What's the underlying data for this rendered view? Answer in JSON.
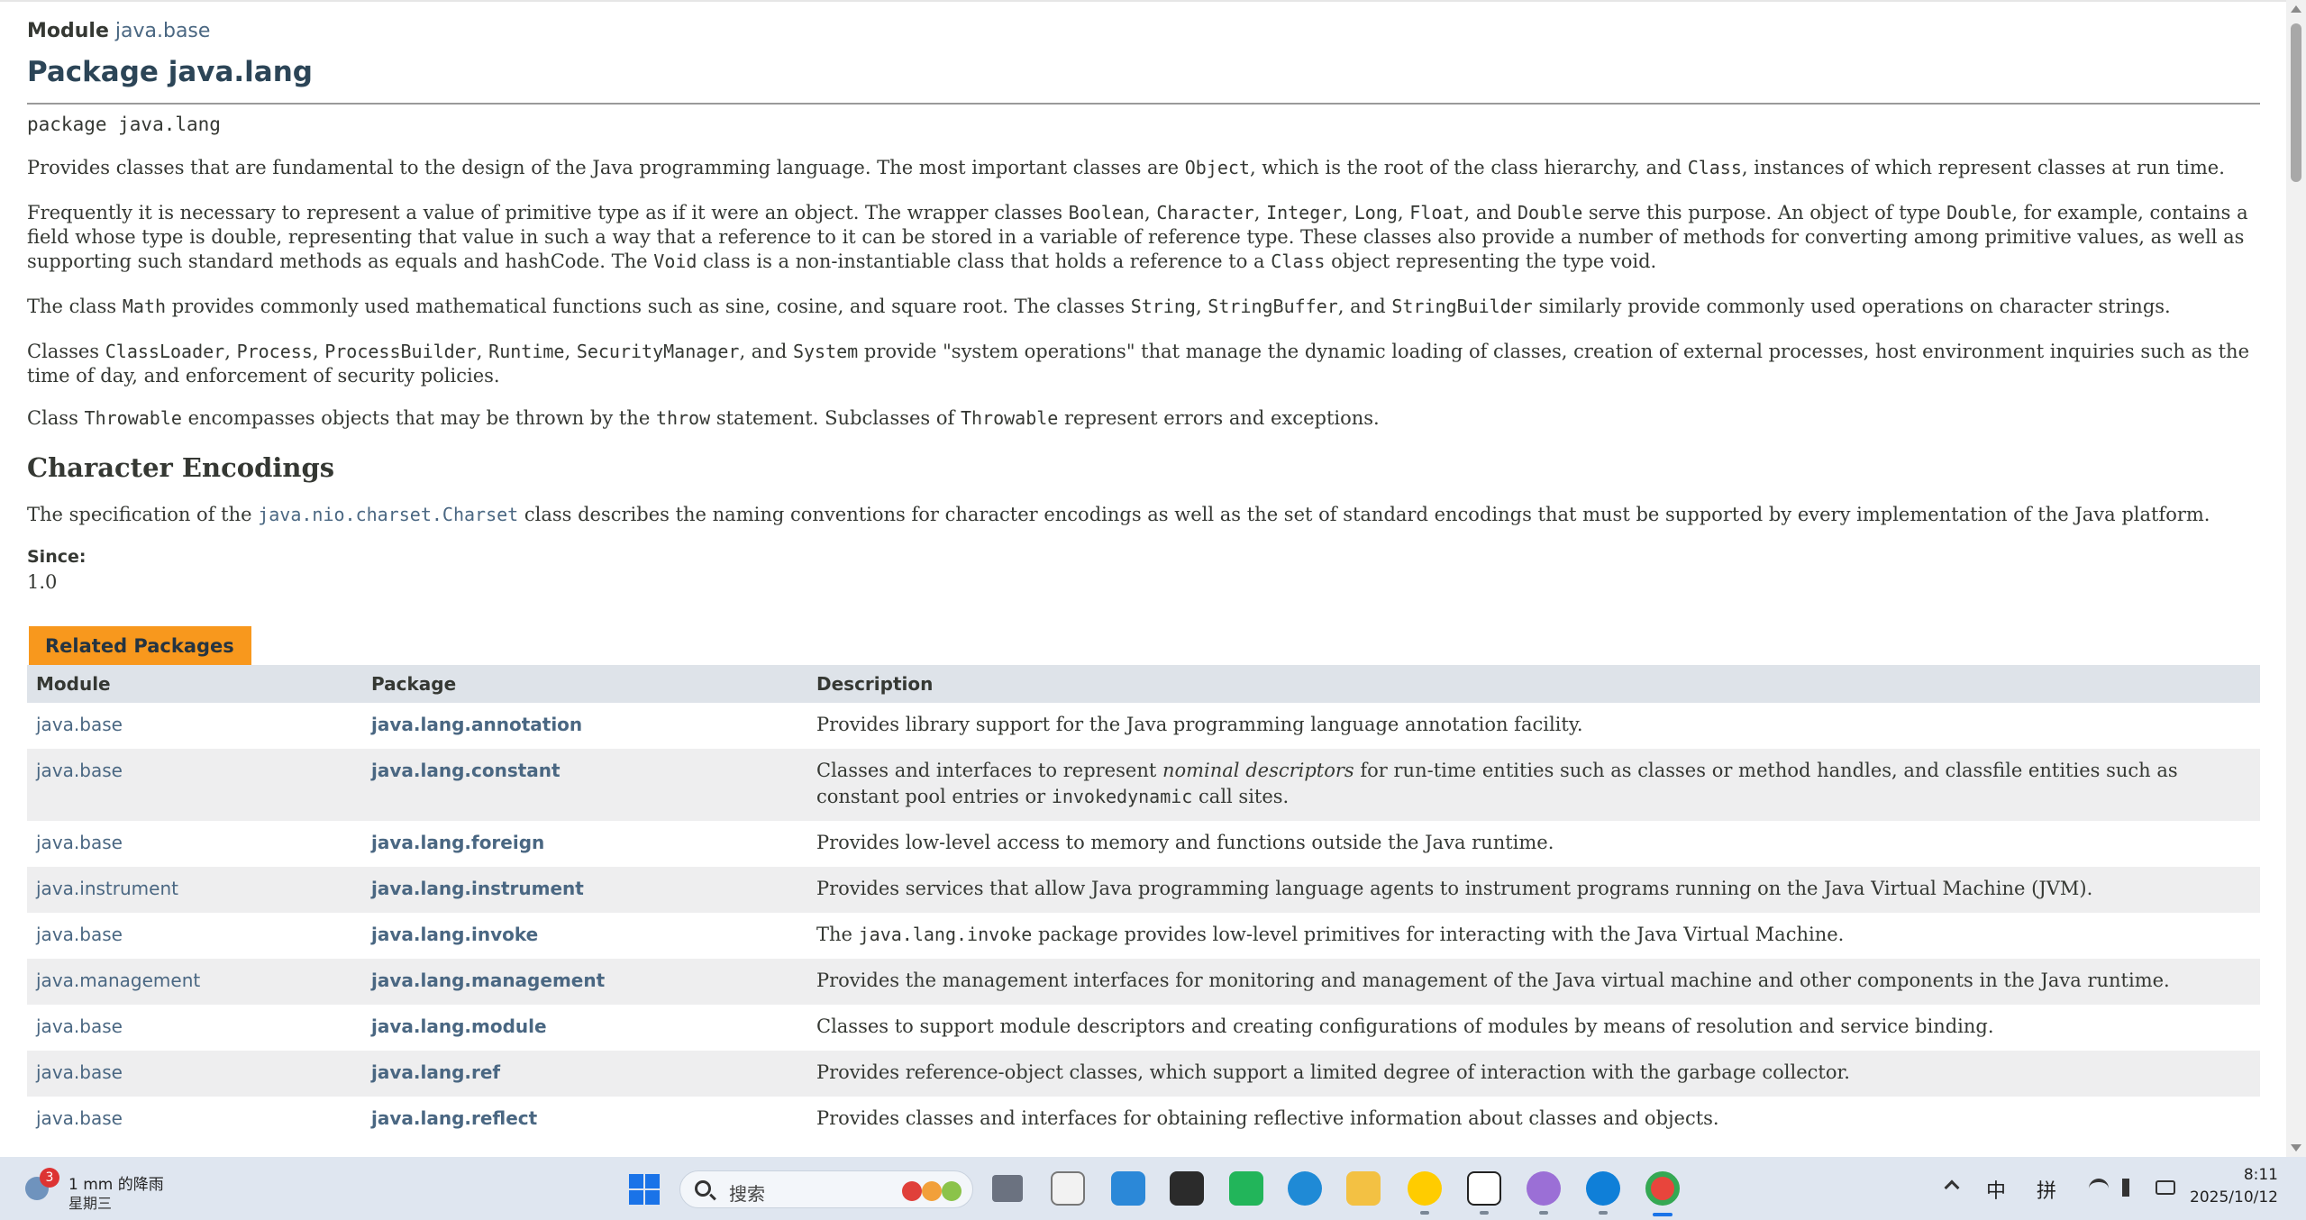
{
  "page": {
    "module_label": "Module",
    "module_name": "java.base",
    "title": "Package java.lang",
    "declaration": "package java.lang"
  },
  "paragraphs": {
    "p1": {
      "t1": "Provides classes that are fundamental to the design of the Java programming language. The most important classes are ",
      "c1": "Object",
      "t2": ", which is the root of the class hierarchy, and ",
      "c2": "Class",
      "t3": ", instances of which represent classes at run time."
    },
    "p2": {
      "t1": "Frequently it is necessary to represent a value of primitive type as if it were an object. The wrapper classes ",
      "c1": "Boolean",
      "t2": ", ",
      "c2": "Character",
      "t3": ", ",
      "c3": "Integer",
      "t4": ", ",
      "c4": "Long",
      "t5": ", ",
      "c5": "Float",
      "t6": ", and ",
      "c6": "Double",
      "t7": " serve this purpose. An object of type ",
      "c7": "Double",
      "t8": ", for example, contains a field whose type is double, representing that value in such a way that a reference to it can be stored in a variable of reference type. These classes also provide a number of methods for converting among primitive values, as well as supporting such standard methods as equals and hashCode. The ",
      "c8": "Void",
      "t9": " class is a non-instantiable class that holds a reference to a ",
      "c9": "Class",
      "t10": " object representing the type void."
    },
    "p3": {
      "t1": "The class ",
      "c1": "Math",
      "t2": " provides commonly used mathematical functions such as sine, cosine, and square root. The classes ",
      "c2": "String",
      "t3": ", ",
      "c3": "StringBuffer",
      "t4": ", and ",
      "c4": "StringBuilder",
      "t5": " similarly provide commonly used operations on character strings."
    },
    "p4": {
      "t1": "Classes ",
      "c1": "ClassLoader",
      "t2": ", ",
      "c2": "Process",
      "t3": ", ",
      "c3": "ProcessBuilder",
      "t4": ", ",
      "c4": "Runtime",
      "t5": ", ",
      "c5": "SecurityManager",
      "t6": ", and ",
      "c6": "System",
      "t7": " provide \"system operations\" that manage the dynamic loading of classes, creation of external processes, host environment inquiries such as the time of day, and enforcement of security policies."
    },
    "p5": {
      "t1": "Class ",
      "c1": "Throwable",
      "t2": " encompasses objects that may be thrown by the ",
      "c2": "throw",
      "t3": " statement. Subclasses of ",
      "c3": "Throwable",
      "t4": " represent errors and exceptions."
    },
    "encodings_heading": "Character Encodings",
    "p6": {
      "t1": "The specification of the ",
      "link": "java.nio.charset.Charset",
      "t2": " class describes the naming conventions for character encodings as well as the set of standard encodings that must be supported by every implementation of the Java platform."
    },
    "since_label": "Since:",
    "since_value": "1.0"
  },
  "related": {
    "tab_label": "Related Packages",
    "headers": [
      "Module",
      "Package",
      "Description"
    ],
    "rows": [
      {
        "module": "java.base",
        "package": "java.lang.annotation",
        "desc": "Provides library support for the Java programming language annotation facility."
      },
      {
        "module": "java.base",
        "package": "java.lang.constant",
        "desc_a": "Classes and interfaces to represent ",
        "desc_em": "nominal descriptors",
        "desc_b": " for run-time entities such as classes or method handles, and classfile entities such as constant pool entries or ",
        "desc_code": "invokedynamic",
        "desc_c": " call sites."
      },
      {
        "module": "java.base",
        "package": "java.lang.foreign",
        "desc": "Provides low-level access to memory and functions outside the Java runtime."
      },
      {
        "module": "java.instrument",
        "package": "java.lang.instrument",
        "desc": "Provides services that allow Java programming language agents to instrument programs running on the Java Virtual Machine (JVM)."
      },
      {
        "module": "java.base",
        "package": "java.lang.invoke",
        "desc_a": "The ",
        "desc_code": "java.lang.invoke",
        "desc_b": " package provides low-level primitives for interacting with the Java Virtual Machine."
      },
      {
        "module": "java.management",
        "package": "java.lang.management",
        "desc": "Provides the management interfaces for monitoring and management of the Java virtual machine and other components in the Java runtime."
      },
      {
        "module": "java.base",
        "package": "java.lang.module",
        "desc": "Classes to support module descriptors and creating configurations of modules by means of resolution and service binding."
      },
      {
        "module": "java.base",
        "package": "java.lang.ref",
        "desc": "Provides reference-object classes, which support a limited degree of interaction with the garbage collector."
      },
      {
        "module": "java.base",
        "package": "java.lang.reflect",
        "desc": "Provides classes and interfaces for obtaining reflective information about classes and objects."
      }
    ]
  },
  "taskbar": {
    "weather_badge": "3",
    "weather_temp": "1 mm 的降雨",
    "weather_day": "星期三",
    "search_placeholder": "搜索",
    "tray_lang": "中",
    "tray_ime": "拼",
    "clock_time": "8:11",
    "clock_date": "2025/10/12"
  }
}
